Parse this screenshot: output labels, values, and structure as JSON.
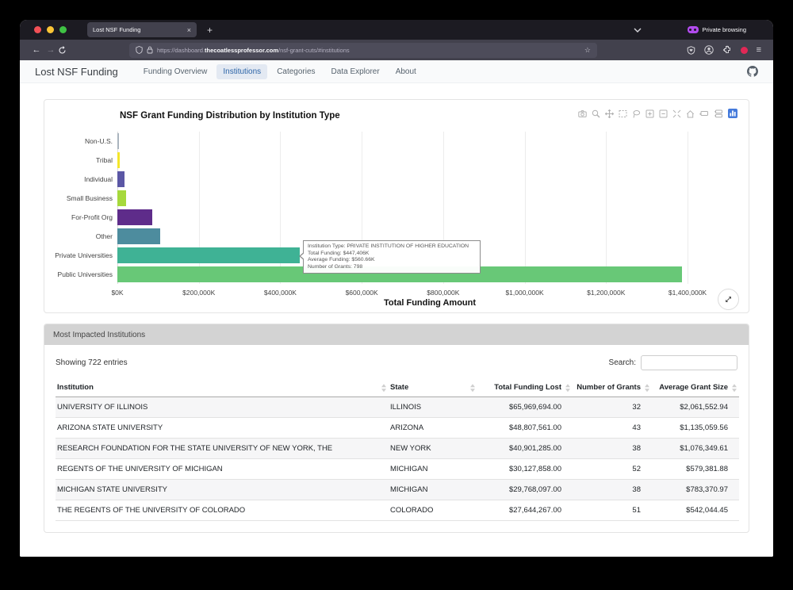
{
  "browser": {
    "tab_title": "Lost NSF Funding",
    "new_tab": "+",
    "close_tab": "×",
    "url_prefix": "https://dashboard.",
    "url_domain": "thecoatlessprofessor.com",
    "url_path": "/nsf-grant-cuts/#institutions",
    "private_badge": "Private browsing",
    "back": "←",
    "forward": "→"
  },
  "nav": {
    "brand": "Lost NSF Funding",
    "items": [
      {
        "label": "Funding Overview",
        "active": false
      },
      {
        "label": "Institutions",
        "active": true
      },
      {
        "label": "Categories",
        "active": false
      },
      {
        "label": "Data Explorer",
        "active": false
      },
      {
        "label": "About",
        "active": false
      }
    ]
  },
  "chart_data": {
    "type": "bar",
    "orientation": "horizontal",
    "title": "NSF Grant Funding Distribution by Institution Type",
    "xlabel": "Total Funding Amount",
    "categories": [
      "Non-U.S.",
      "Tribal",
      "Individual",
      "Small Business",
      "For-Profit Org",
      "Other",
      "Private Universities",
      "Public Universities"
    ],
    "values_thousands": [
      1500,
      6000,
      18000,
      22000,
      85000,
      105000,
      447406,
      1386000
    ],
    "colors": [
      "#aab4be",
      "#f4e62a",
      "#5b57a5",
      "#a6d93c",
      "#5e2c8a",
      "#4d8c9e",
      "#3fb295",
      "#68c877"
    ],
    "xlim_thousands": [
      0,
      1400000
    ],
    "x_ticks": [
      "$0K",
      "$200,000K",
      "$400,000K",
      "$600,000K",
      "$800,000K",
      "$1,000,000K",
      "$1,200,000K",
      "$1,400,000K"
    ],
    "grid": true,
    "legend": false,
    "tooltip_lines": [
      "Institution Type: PRIVATE INSTITUTION OF HIGHER EDUCATION",
      "Total Funding: $447,406K",
      "Average Funding: $560.66K",
      "Number of Grants: 798"
    ]
  },
  "table": {
    "card_title": "Most Impacted Institutions",
    "showing_text": "Showing 722 entries",
    "search_label": "Search:",
    "search_value": "",
    "search_placeholder": "",
    "columns": [
      "Institution",
      "State",
      "Total Funding Lost",
      "Number of Grants",
      "Average Grant Size"
    ],
    "rows": [
      [
        "UNIVERSITY OF ILLINOIS",
        "ILLINOIS",
        "$65,969,694.00",
        "32",
        "$2,061,552.94"
      ],
      [
        "ARIZONA STATE UNIVERSITY",
        "ARIZONA",
        "$48,807,561.00",
        "43",
        "$1,135,059.56"
      ],
      [
        "RESEARCH FOUNDATION FOR THE STATE UNIVERSITY OF NEW YORK, THE",
        "NEW YORK",
        "$40,901,285.00",
        "38",
        "$1,076,349.61"
      ],
      [
        "REGENTS OF THE UNIVERSITY OF MICHIGAN",
        "MICHIGAN",
        "$30,127,858.00",
        "52",
        "$579,381.88"
      ],
      [
        "MICHIGAN STATE UNIVERSITY",
        "MICHIGAN",
        "$29,768,097.00",
        "38",
        "$783,370.97"
      ],
      [
        "THE REGENTS OF THE UNIVERSITY OF COLORADO",
        "COLORADO",
        "$27,644,267.00",
        "51",
        "$542,044.45"
      ]
    ]
  }
}
